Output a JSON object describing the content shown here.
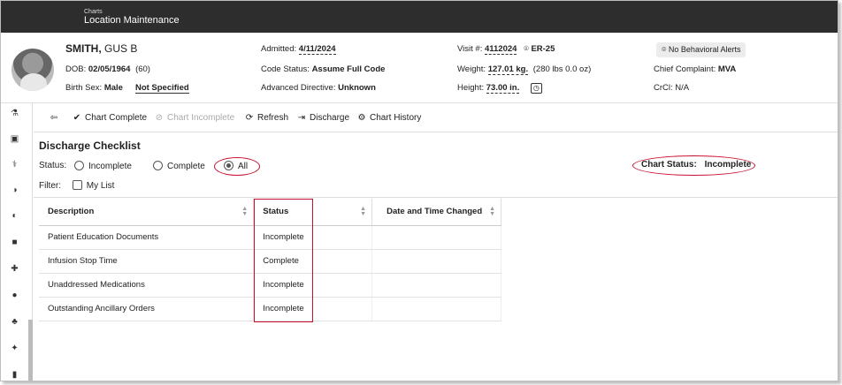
{
  "header": {
    "breadcrumb": "Charts",
    "title": "Location Maintenance"
  },
  "patient": {
    "last_name": "SMITH,",
    "first_name": " GUS B",
    "dob_label": "DOB:",
    "dob": "02/05/1964",
    "age": "(60)",
    "birth_sex_label": "Birth Sex:",
    "birth_sex": "Male",
    "gender": "Not Specified",
    "admitted_label": "Admitted:",
    "admitted": "4/11/2024",
    "code_status_label": "Code Status:",
    "code_status": "Assume Full Code",
    "directive_label": "Advanced Directive:",
    "directive": "Unknown",
    "visit_label": "Visit #:",
    "visit": "4112024",
    "location": "ER-25",
    "weight_label": "Weight:",
    "weight": "127.01 kg.",
    "weight_lbs": "(280 lbs 0.0 oz)",
    "height_label": "Height:",
    "height": "73.00 in.",
    "alert": "No Behavioral Alerts",
    "complaint_label": "Chief Complaint:",
    "complaint": "MVA",
    "crcl_label": "CrCl:",
    "crcl": "N/A"
  },
  "toolbar": {
    "chart_complete": "Chart Complete",
    "chart_incomplete": "Chart Incomplete",
    "refresh": "Refresh",
    "discharge": "Discharge",
    "chart_history": "Chart History"
  },
  "checklist": {
    "title": "Discharge Checklist",
    "status_label": "Status:",
    "options": [
      "Incomplete",
      "Complete",
      "All"
    ],
    "selected": "All",
    "filter_label": "Filter:",
    "my_list": "My List",
    "chart_status_label": "Chart Status:",
    "chart_status": "Incomplete"
  },
  "table": {
    "columns": [
      "Description",
      "Status",
      "Date and Time Changed"
    ],
    "rows": [
      [
        "Patient Education Documents",
        "Incomplete",
        ""
      ],
      [
        "Infusion Stop Time",
        "Complete",
        ""
      ],
      [
        "Unaddressed Medications",
        "Incomplete",
        ""
      ],
      [
        "Outstanding Ancillary Orders",
        "Incomplete",
        ""
      ]
    ]
  },
  "colors": {
    "annotation": "#c8102e",
    "header_bg": "#2d2d2d"
  }
}
